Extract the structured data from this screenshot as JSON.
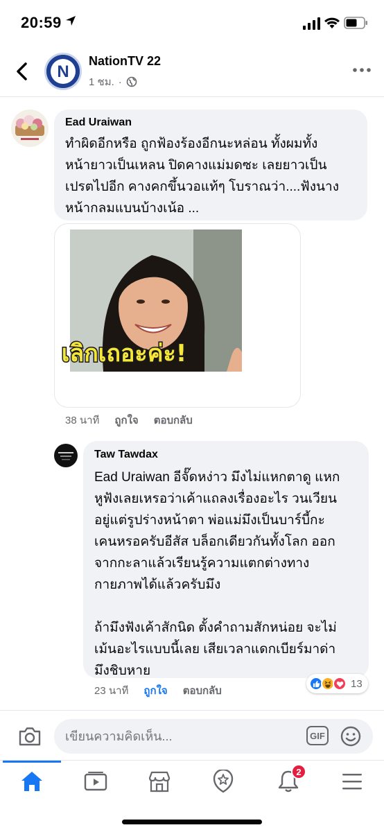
{
  "status_bar": {
    "time": "20:59"
  },
  "header": {
    "page_name": "NationTV 22",
    "post_time": "1 ชม.",
    "logo_letter": "N",
    "brand_color": "#1f3f93"
  },
  "comments": [
    {
      "author": "Ead Uraiwan",
      "text": "ทำผิดอีกหรือ ถูกฟ้องร้องอีกนะหล่อน ทั้งผมทั้ง\nหน้ายาวเป็นเหลน ปิดคางแม่มดซะ  เลยยาวเป็น\nเปรตไปอีก คางคกขึ้นวอแท้ๆ โบราณว่า....ฟังนาง\nหน้ากลมแบนบ้างเน้อ  ...",
      "sticker_text": "เลิกเถอะค่ะ!",
      "time": "38 นาที",
      "like_label": "ถูกใจ",
      "reply_label": "ตอบกลับ"
    },
    {
      "author": "Taw Tawdax",
      "mention": "Ead Uraiwan",
      "text": " อีจั๊ดหง่าว มึงไม่แหกตาดู แหก\nหูฟังเลยเหรอว่าเค้าแถลงเรื่องอะไร วนเวียน\nอยู่แต่รูปร่างหน้าตา พ่อแม่มึงเป็นบาร์บี้กะ\nเคนหรอครับอีสัส บล็อกเดียวกันทั้งโลก ออก\nจากกะลาแล้วเรียนรู้ความแตกต่างทาง\nกายภาพได้แล้วครับมึง\n\nถ้ามึงฟังเค้าสักนิด ตั้งคำถามสักหน่อย จะไม่\nเม้นอะไรแบบนี้เลย เสียเวลาแดกเบียร์มาด่า\nมึงชิบหาย",
      "time": "23 นาที",
      "like_label": "ถูกใจ",
      "reply_label": "ตอบกลับ",
      "reaction_count": "13",
      "reaction_icons": [
        "like-icon",
        "haha-icon",
        "love-icon"
      ]
    }
  ],
  "composer": {
    "placeholder": "เขียนความคิดเห็น...",
    "gif_label": "GIF"
  },
  "tabbar": {
    "items": [
      "home",
      "watch",
      "marketplace",
      "pages",
      "notifications",
      "menu"
    ],
    "notification_count": "2",
    "active_color": "#1877f2"
  }
}
